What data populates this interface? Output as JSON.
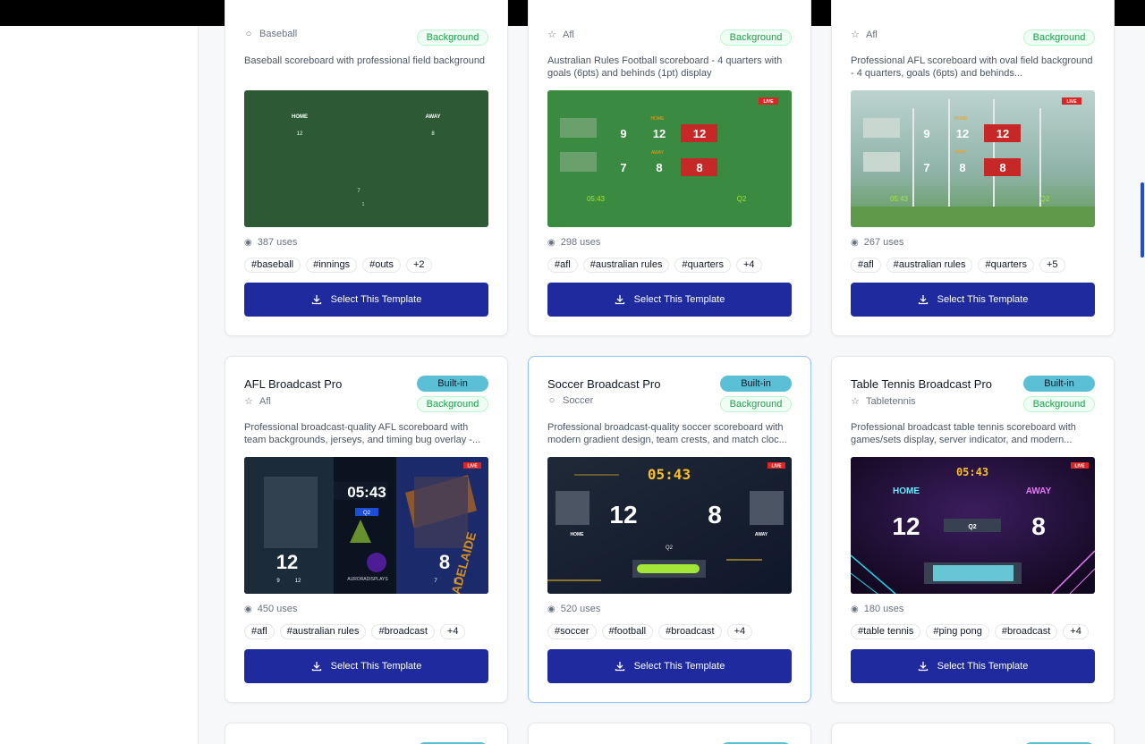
{
  "cards": [
    {
      "title": "",
      "sport": "Baseball",
      "sport_icon": "circle-icon",
      "builtin": "",
      "background": "Background",
      "description": "Baseball scoreboard with professional field background",
      "uses": "387 uses",
      "tags": [
        "#baseball",
        "#innings",
        "#outs",
        "+2"
      ],
      "button": "Select This Template",
      "thumb": {
        "home_label": "HOME",
        "away_label": "AWAY",
        "home_score": "12",
        "away_score": "8",
        "inning": "7",
        "outs": "1"
      }
    },
    {
      "title": "",
      "sport": "Afl",
      "sport_icon": "star-icon",
      "builtin": "",
      "background": "Background",
      "description": "Australian Rules Football scoreboard - 4 quarters with goals (6pts) and behinds (1pt) display",
      "uses": "298 uses",
      "tags": [
        "#afl",
        "#australian rules",
        "#quarters",
        "+4"
      ],
      "button": "Select This Template",
      "thumb": {
        "live": "LIVE",
        "home_label": "HOME",
        "away_label": "AWAY",
        "home_goals": "9",
        "home_behinds": "12",
        "home_total": "12",
        "away_goals": "7",
        "away_behinds": "8",
        "away_total": "8",
        "clock": "05:43",
        "period": "Q2"
      }
    },
    {
      "title": "",
      "sport": "Afl",
      "sport_icon": "star-icon",
      "builtin": "",
      "background": "Background",
      "description": "Professional AFL scoreboard with oval field background - 4 quarters, goals (6pts) and behinds...",
      "uses": "267 uses",
      "tags": [
        "#afl",
        "#australian rules",
        "#quarters",
        "+5"
      ],
      "button": "Select This Template",
      "thumb": {
        "live": "LIVE",
        "home_label": "HOME",
        "away_label": "AWAY",
        "home_goals": "9",
        "home_behinds": "12",
        "home_total": "12",
        "away_goals": "7",
        "away_behinds": "8",
        "away_total": "8",
        "clock": "05:43",
        "period": "Q2"
      }
    },
    {
      "title": "AFL Broadcast Pro",
      "sport": "Afl",
      "sport_icon": "star-icon",
      "builtin": "Built-in",
      "background": "Background",
      "description": "Professional broadcast-quality AFL scoreboard with team backgrounds, jerseys, and timing bug overlay -...",
      "uses": "450 uses",
      "tags": [
        "#afl",
        "#australian rules",
        "#broadcast",
        "+4"
      ],
      "button": "Select This Template",
      "thumb": {
        "live": "LIVE",
        "clock": "05:43",
        "period": "Q2",
        "home_score": "12",
        "away_score": "8",
        "home_sub1": "9",
        "home_sub2": "12",
        "away_sub1": "7",
        "away_sub2": "8",
        "brand": "AURORADISPLAYS",
        "away_text": "ADELAIDE"
      }
    },
    {
      "title": "Soccer Broadcast Pro",
      "sport": "Soccer",
      "sport_icon": "circle-icon",
      "builtin": "Built-in",
      "background": "Background",
      "description": "Professional broadcast-quality soccer scoreboard with modern gradient design, team crests, and match cloc...",
      "uses": "520 uses",
      "tags": [
        "#soccer",
        "#football",
        "#broadcast",
        "+4"
      ],
      "button": "Select This Template",
      "thumb": {
        "live": "LIVE",
        "clock": "05:43",
        "home_score": "12",
        "away_score": "8",
        "home_label": "HOME",
        "away_label": "AWAY",
        "period": "Q2"
      }
    },
    {
      "title": "Table Tennis Broadcast Pro",
      "sport": "Tabletennis",
      "sport_icon": "star-icon",
      "builtin": "Built-in",
      "background": "Background",
      "description": "Professional broadcast table tennis scoreboard with games/sets display, server indicator, and modern...",
      "uses": "180 uses",
      "tags": [
        "#table tennis",
        "#ping pong",
        "#broadcast",
        "+4"
      ],
      "button": "Select This Template",
      "thumb": {
        "live": "LIVE",
        "clock": "05:43",
        "home_label": "HOME",
        "away_label": "AWAY",
        "home_score": "12",
        "away_score": "8",
        "period": "Q2"
      }
    }
  ],
  "colors": {
    "primary_button": "#1e2a9e",
    "builtin_badge": "#5bc0d6",
    "background_badge": "#16a34a",
    "live": "#dc2626"
  }
}
